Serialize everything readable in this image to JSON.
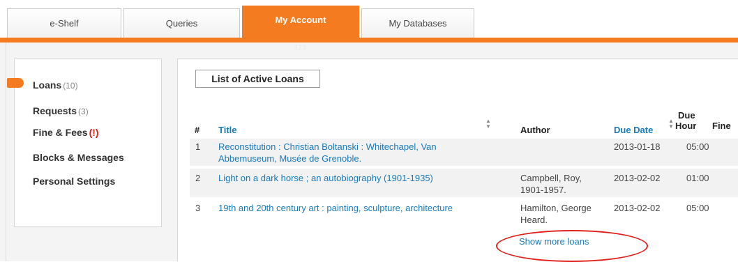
{
  "tabs": [
    {
      "label": "e-Shelf",
      "active": false
    },
    {
      "label": "Queries",
      "active": false
    },
    {
      "label": "My Account",
      "active": true
    },
    {
      "label": "My Databases",
      "active": false
    }
  ],
  "tab_sub_label": "123",
  "sidebar": {
    "items": [
      {
        "label": "Loans",
        "count": "(10)",
        "selected": true
      },
      {
        "label": "Requests",
        "count": "(3)"
      },
      {
        "label": "Fine & Fees",
        "alert": "(!)"
      },
      {
        "label": "Blocks & Messages"
      },
      {
        "label": "Personal Settings"
      }
    ]
  },
  "main": {
    "title": "List of Active Loans",
    "columns": {
      "num": "#",
      "title": "Title",
      "author": "Author",
      "due_date": "Due Date",
      "due_hour_1": "Due",
      "due_hour_2": "Hour",
      "fine": "Fine"
    },
    "rows": [
      {
        "num": "1",
        "title_1": "Reconstitution : Christian Boltanski : Whitechapel, Van",
        "title_2": "Abbemuseum, Musée de Grenoble.",
        "author_1": "",
        "author_2": "",
        "due_date": "2013-01-18",
        "due_hour": "05:00"
      },
      {
        "num": "2",
        "title_1": "Light on a dark horse ; an autobiography (1901-1935)",
        "title_2": "",
        "author_1": "Campbell, Roy,",
        "author_2": "1901-1957.",
        "due_date": "2013-02-02",
        "due_hour": "01:00"
      },
      {
        "num": "3",
        "title_1": "19th and 20th century art : painting, sculpture, architecture",
        "title_2": "",
        "author_1": "Hamilton, George",
        "author_2": "Heard.",
        "due_date": "2013-02-02",
        "due_hour": "05:00"
      }
    ],
    "show_more": "Show more loans"
  },
  "colors": {
    "accent": "#f47b20",
    "link": "#1a7ab8",
    "alert": "#e0201c"
  }
}
